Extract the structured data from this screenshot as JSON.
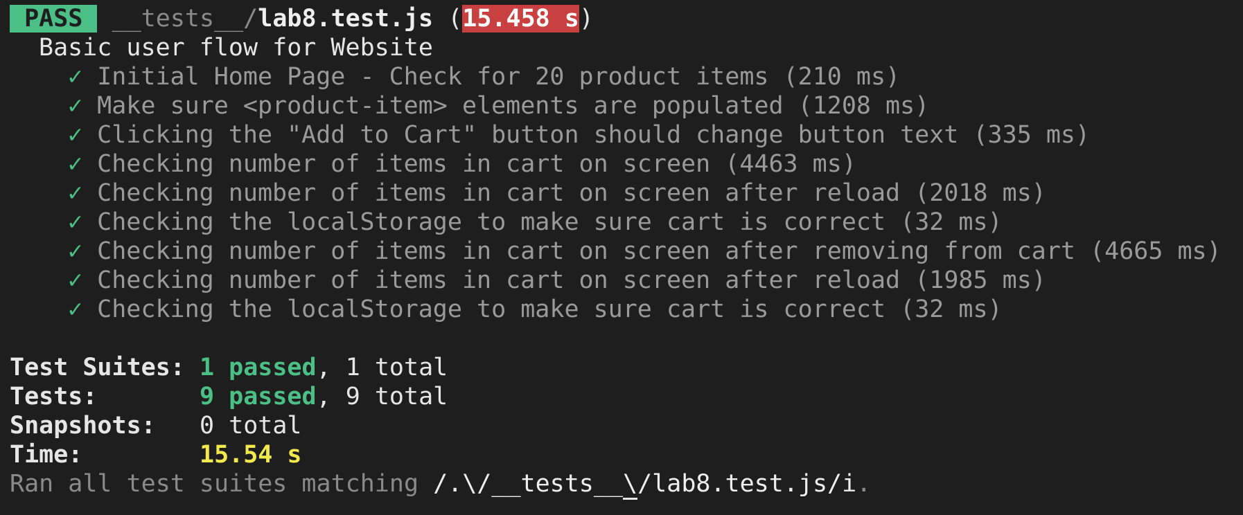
{
  "header": {
    "status": "PASS",
    "path_prefix": "__tests__/",
    "filename": "lab8.test.js",
    "open_paren": " (",
    "duration": "15.458 s",
    "close_paren": ")"
  },
  "suite": {
    "name": "Basic user flow for Website",
    "check_glyph": "✓",
    "tests": [
      {
        "name": "Initial Home Page - Check for 20 product items",
        "time": "(210 ms)"
      },
      {
        "name": "Make sure <product-item> elements are populated",
        "time": "(1208 ms)"
      },
      {
        "name": "Clicking the \"Add to Cart\" button should change button text",
        "time": "(335 ms)"
      },
      {
        "name": "Checking number of items in cart on screen",
        "time": "(4463 ms)"
      },
      {
        "name": "Checking number of items in cart on screen after reload",
        "time": "(2018 ms)"
      },
      {
        "name": "Checking the localStorage to make sure cart is correct",
        "time": "(32 ms)"
      },
      {
        "name": "Checking number of items in cart on screen after removing from cart",
        "time": "(4665 ms)"
      },
      {
        "name": "Checking number of items in cart on screen after reload",
        "time": "(1985 ms)"
      },
      {
        "name": "Checking the localStorage to make sure cart is correct",
        "time": "(32 ms)"
      }
    ]
  },
  "summary": {
    "suites_label": "Test Suites:",
    "suites_passed": "1 passed",
    "suites_total": ", 1 total",
    "tests_label": "Tests:",
    "tests_passed": "9 passed",
    "tests_total": ", 9 total",
    "snapshots_label": "Snapshots:",
    "snapshots_total": "0 total",
    "time_label": "Time:",
    "time_value": "15.54 s"
  },
  "footer": {
    "prefix": "Ran all test suites matching ",
    "pattern_before_cursor": "/.\\/__tests__",
    "pattern_cursor_char": "\\",
    "pattern_after_cursor": "/lab8.test.js/i",
    "suffix": "."
  },
  "colors": {
    "background": "#1e1e1e",
    "pass_green": "#4cbf86",
    "fail_red": "#c94040",
    "time_yellow": "#f2e94e",
    "dim_gray": "#8a8a8a"
  }
}
